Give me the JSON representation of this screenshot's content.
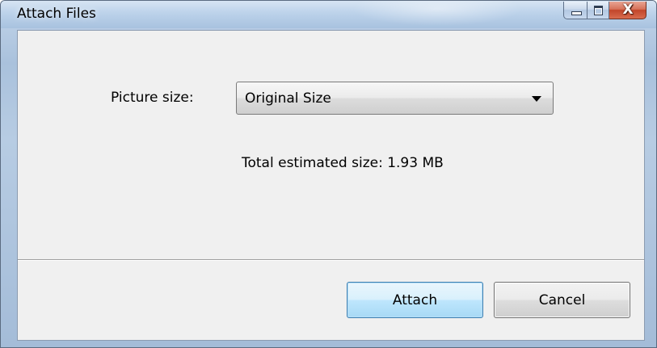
{
  "window": {
    "title": "Attach Files"
  },
  "caption_buttons": {
    "minimize_icon": "minimize-icon",
    "maximize_icon": "maximize-icon",
    "close_glyph": "X"
  },
  "form": {
    "picture_size_label": "Picture size:",
    "picture_size_value": "Original Size",
    "total_size_text": "Total estimated size: 1.93 MB"
  },
  "buttons": {
    "attach_label": "Attach",
    "cancel_label": "Cancel"
  },
  "colors": {
    "titlebar": "#bcd2ea",
    "client_background": "#f0f0f0",
    "close_button": "#c2452a",
    "default_button_border": "#3c7fb1"
  }
}
